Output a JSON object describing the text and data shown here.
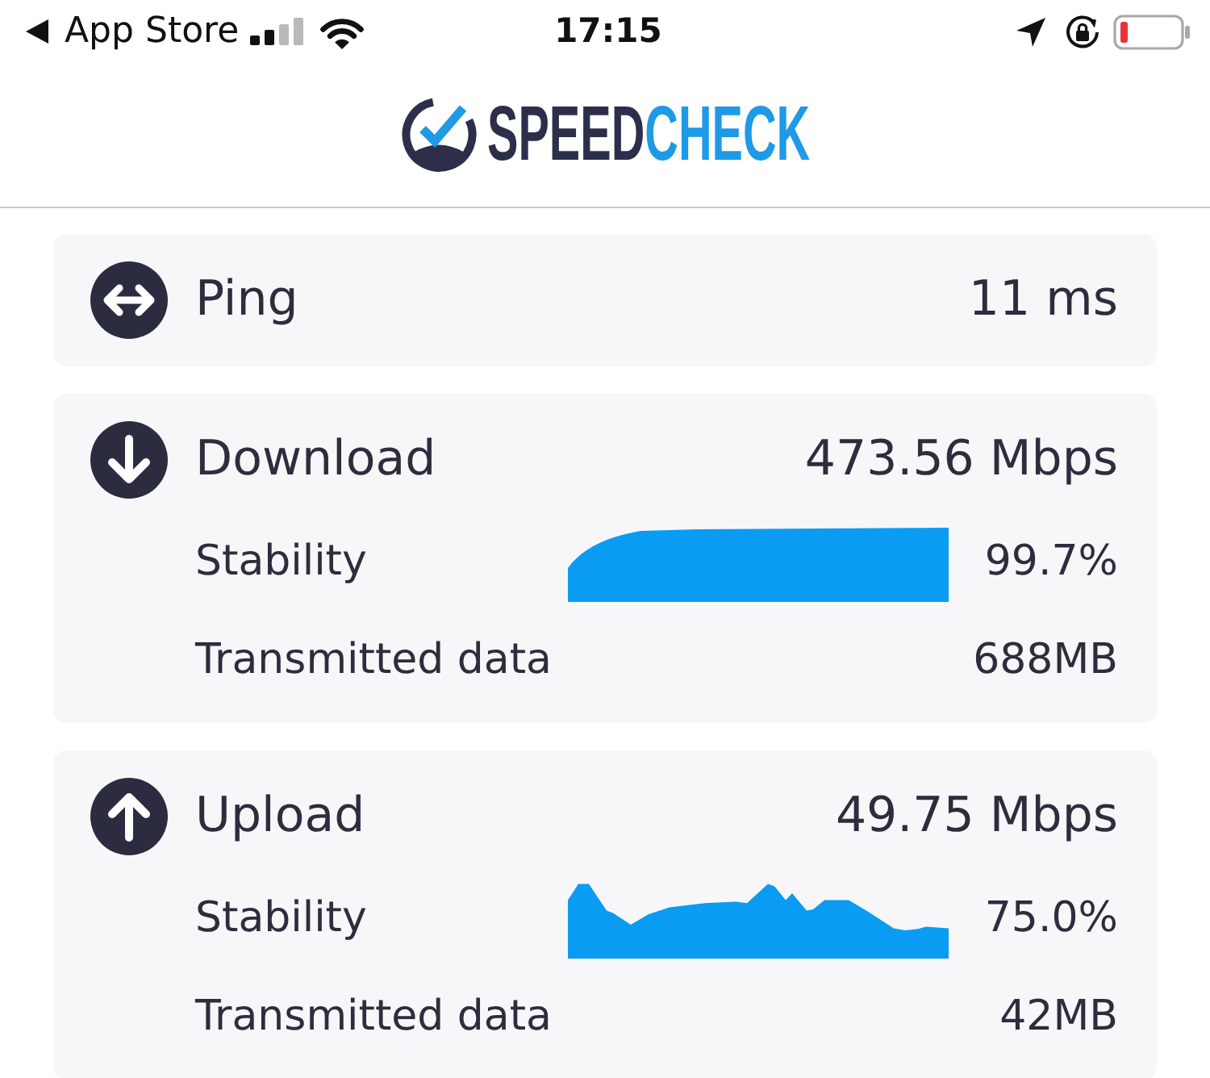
{
  "status_bar": {
    "back_label": "App Store",
    "time": "17:15"
  },
  "header": {
    "logo_primary": "SPEED",
    "logo_accent": "CHECK"
  },
  "results": [
    {
      "kind": "ping",
      "label": "Ping",
      "value": "11 ms"
    },
    {
      "kind": "download",
      "label": "Download",
      "value": "473.56 Mbps",
      "details": [
        {
          "kind": "graph",
          "label": "Stability",
          "value": "99.7%"
        },
        {
          "kind": "plain",
          "label": "Transmitted data",
          "value": "688MB"
        }
      ]
    },
    {
      "kind": "upload",
      "label": "Upload",
      "value": "49.75 Mbps",
      "details": [
        {
          "kind": "graph",
          "label": "Stability",
          "value": "75.0%"
        },
        {
          "kind": "plain",
          "label": "Transmitted data",
          "value": "42MB"
        }
      ]
    }
  ]
}
